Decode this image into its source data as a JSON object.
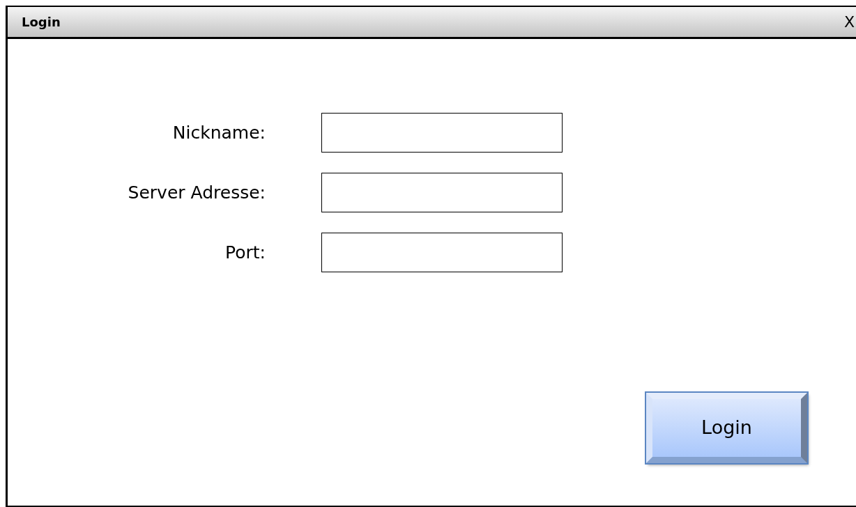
{
  "window": {
    "title": "Login",
    "close_label": "X"
  },
  "fields": [
    {
      "label": "Nickname:"
    },
    {
      "label": "Server Adresse:"
    },
    {
      "label": "Port:"
    }
  ],
  "buttons": [
    "Login"
  ]
}
